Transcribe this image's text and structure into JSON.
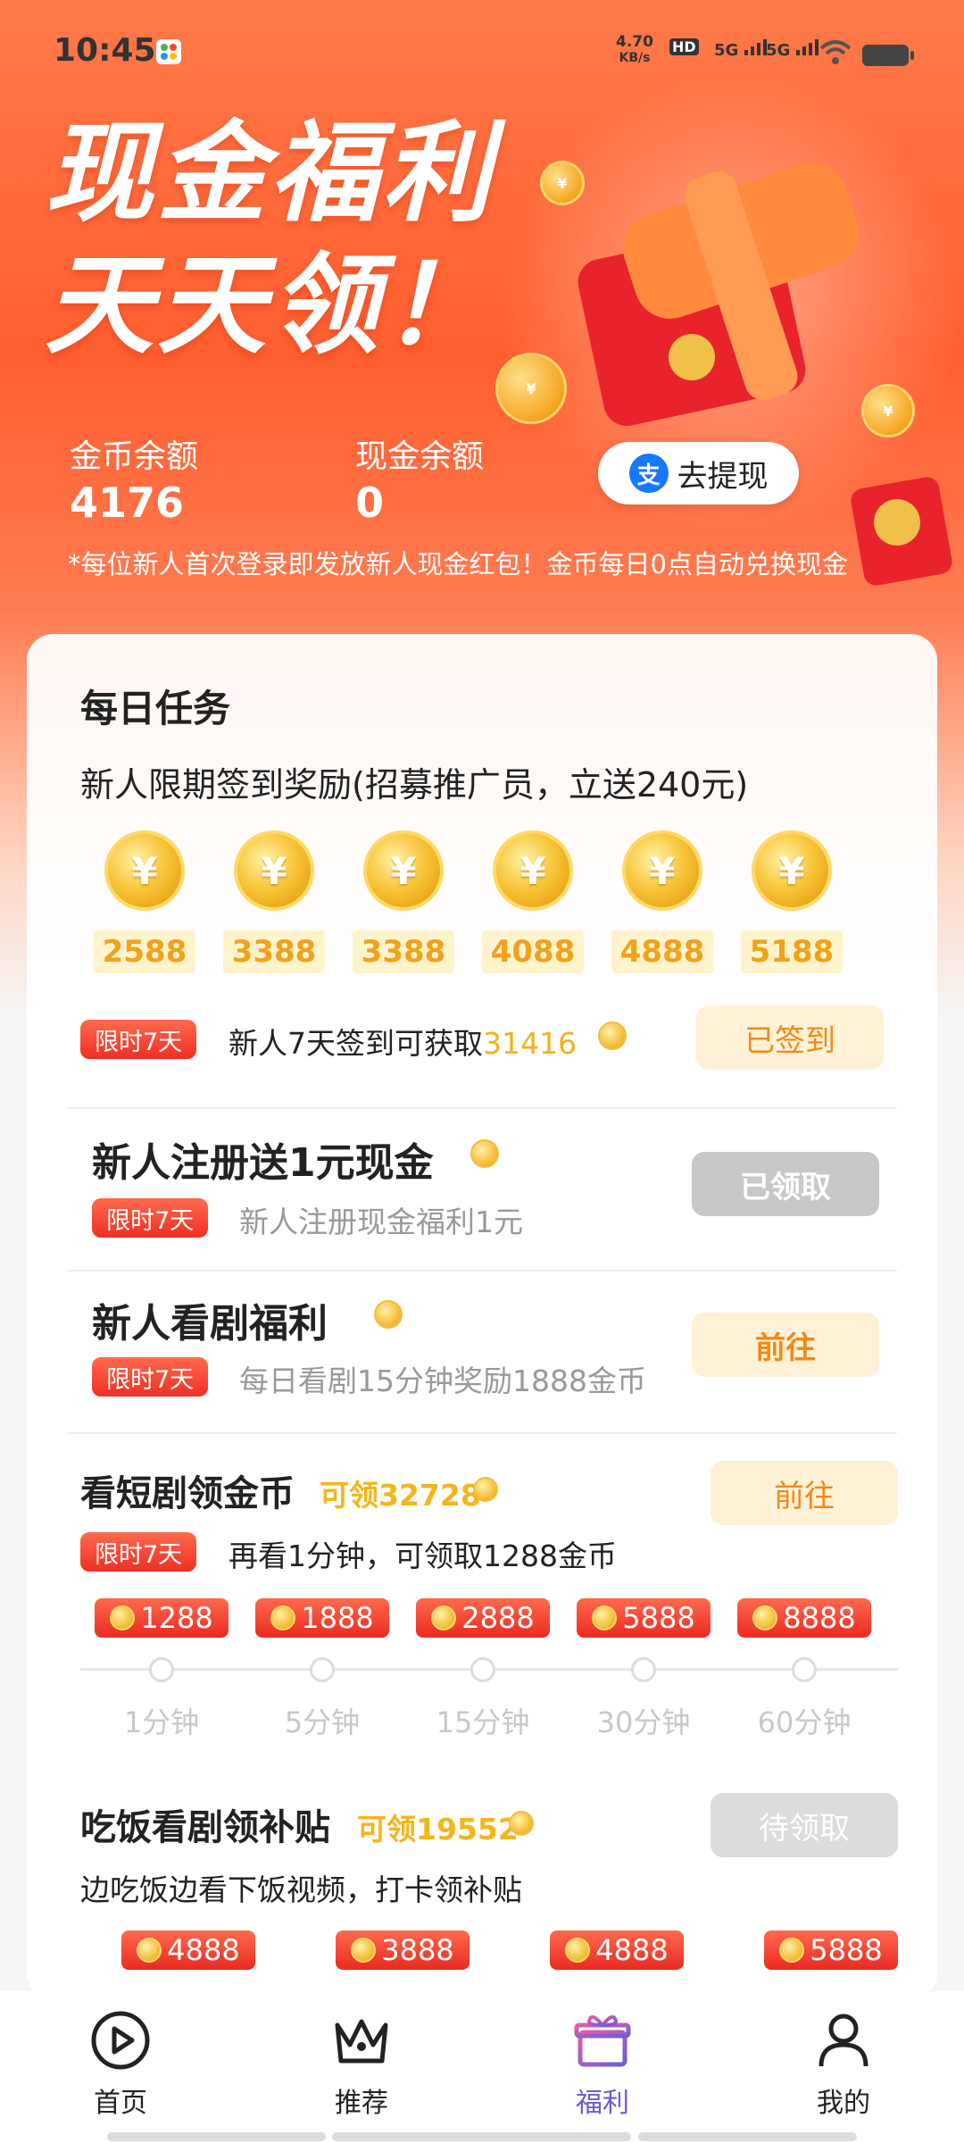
{
  "status_bar": {
    "time": "10:45",
    "net_speed_value": "4.70",
    "net_speed_unit": "KB/s",
    "hd_label": "HD",
    "sim1": "5G",
    "sim2": "5G"
  },
  "hero": {
    "title_line1": "现金福利",
    "title_line2": "天天领！",
    "coin_balance_label": "金币余额",
    "coin_balance_value": "4176",
    "cash_balance_label": "现金余额",
    "cash_balance_value": "0",
    "withdraw_label": "去提现",
    "withdraw_icon_text": "支",
    "notice": "*每位新人首次登录即发放新人现金红包！金币每日0点自动兑换现金"
  },
  "daily_tasks": {
    "title": "每日任务",
    "checkin_title": "新人限期签到奖励(招募推广员，立送240元)",
    "coin_symbol": "¥",
    "checkin_amounts": [
      "2588",
      "3388",
      "3388",
      "4088",
      "4888",
      "5188"
    ],
    "checkin_tag": "限时7天",
    "checkin_text": "新人7天签到可获取",
    "checkin_total": "31416",
    "checkin_button": "已签到"
  },
  "tasks": [
    {
      "title": "新人注册送1元现金",
      "tag": "限时7天",
      "desc": "新人注册现金福利1元",
      "button": "已领取"
    },
    {
      "title": "新人看剧福利",
      "tag": "限时7天",
      "desc": "每日看剧15分钟奖励1888金币",
      "button": "前往"
    }
  ],
  "short_drama": {
    "title": "看短剧领金币",
    "available": "可领32728",
    "tag": "限时7天",
    "desc": "再看1分钟，可领取1288金币",
    "button": "前往",
    "rewards": [
      "1288",
      "1888",
      "2888",
      "5888",
      "8888"
    ],
    "milestones": [
      "1分钟",
      "5分钟",
      "15分钟",
      "30分钟",
      "60分钟"
    ]
  },
  "meal_drama": {
    "title": "吃饭看剧领补贴",
    "available": "可领19552",
    "desc": "边吃饭边看下饭视频，打卡领补贴",
    "button": "待领取",
    "rewards": [
      "4888",
      "3888",
      "4888",
      "5888"
    ]
  },
  "bottom_nav": {
    "home": "首页",
    "recommend": "推荐",
    "welfare": "福利",
    "mine": "我的",
    "active_color": "#6a5cd8"
  }
}
